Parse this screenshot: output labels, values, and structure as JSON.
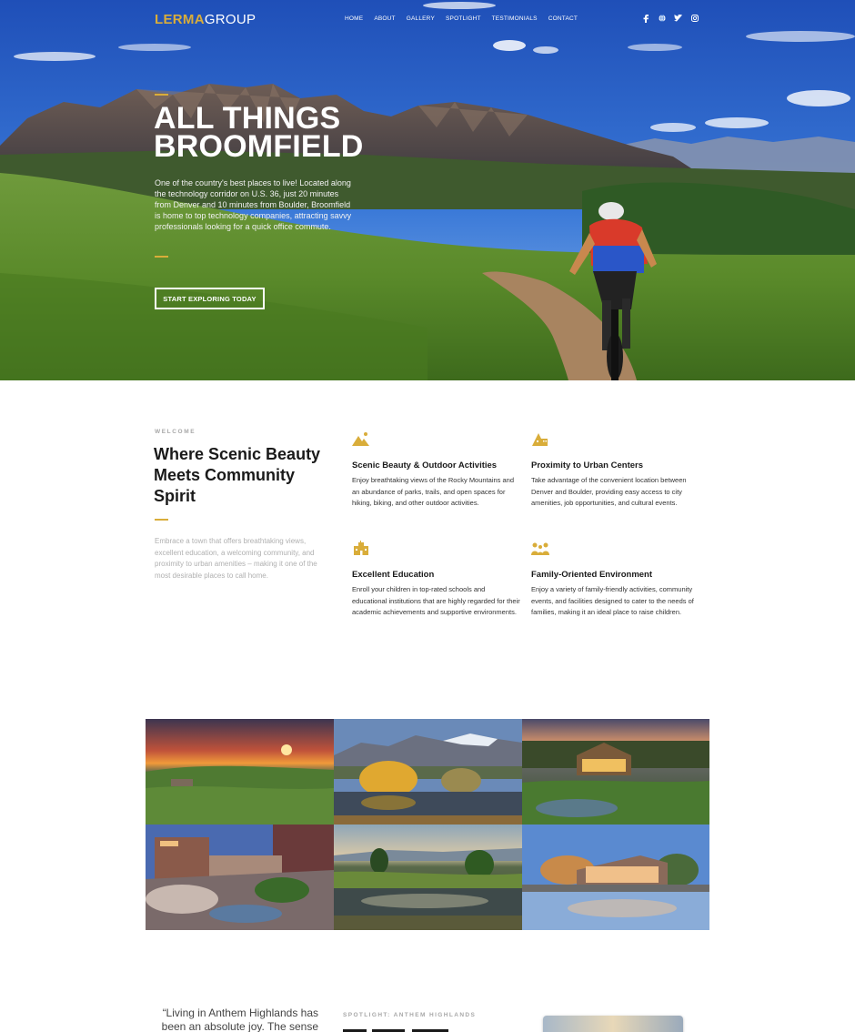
{
  "brand": {
    "logo_primary": "LERMA",
    "logo_secondary": "GROUP",
    "accent_color": "#d9ad3a"
  },
  "nav": {
    "items": [
      "HOME",
      "ABOUT",
      "GALLERY",
      "SPOTLIGHT",
      "TESTIMONIALS",
      "CONTACT"
    ]
  },
  "social": {
    "icons": [
      "facebook-icon",
      "globe-icon",
      "twitter-icon",
      "instagram-icon"
    ]
  },
  "hero": {
    "title_line1": "ALL THINGS",
    "title_line2": "BROOMFIELD",
    "text": "One of the country's best places to live! Located along the technology corridor on U.S. 36, just 20 minutes from Denver and 10 minutes from Boulder, Broomfield is home to top technology companies, attracting savvy professionals looking for a quick office commute.",
    "cta_label": "START EXPLORING TODAY"
  },
  "welcome": {
    "kicker": "WELCOME",
    "title": "Where Scenic Beauty Meets Community Spirit",
    "text": "Embrace a town that offers breathtaking views, excellent education, a welcoming community, and proximity to urban amenities – making it one of the most desirable places to call home."
  },
  "features": [
    {
      "icon": "mountain-icon",
      "title": "Scenic Beauty & Outdoor Activities",
      "text": "Enjoy breathtaking views of the Rocky Mountains and an abundance of parks, trails, and open spaces for hiking, biking, and other outdoor activities."
    },
    {
      "icon": "city-icon",
      "title": "Proximity to Urban Centers",
      "text": "Take advantage of the convenient location between Denver and Boulder, providing easy access to city amenities, job opportunities, and cultural events."
    },
    {
      "icon": "school-icon",
      "title": "Excellent Education",
      "text": "Enroll your children in top-rated schools and educational institutions that are highly regarded for their academic achievements and supportive environments."
    },
    {
      "icon": "family-icon",
      "title": "Family-Oriented Environment",
      "text": "Enjoy a variety of family-friendly activities, community events, and facilities designed to cater to the needs of families, making it an ideal place to raise children."
    }
  ],
  "spotlight": {
    "quote_line1": "“Living in Anthem Highlands has",
    "quote_line2": "been an absolute joy. The sense of",
    "kicker": "SPOTLIGHT: ANTHEM HIGHLANDS"
  }
}
